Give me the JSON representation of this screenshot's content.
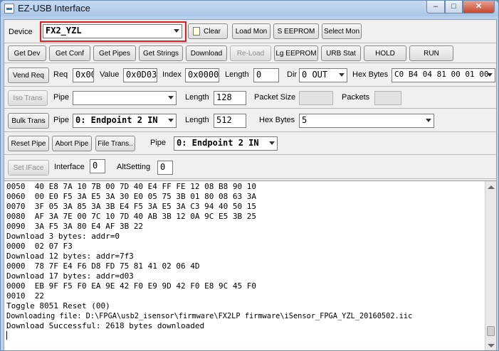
{
  "window": {
    "title": "EZ-USB Interface",
    "controls": {
      "minimize": "–",
      "maximize": "□",
      "close": "✕"
    }
  },
  "device_row": {
    "label": "Device",
    "device_value": "FX2_YZL",
    "clear": "Clear",
    "load_mon": "Load Mon",
    "s_eeprom": "S EEPROM",
    "select_mon": "Select Mon"
  },
  "get_row": {
    "buttons": [
      "Get Dev",
      "Get Conf",
      "Get Pipes",
      "Get Strings",
      "Download",
      "Re-Load",
      "Lg EEPROM",
      "URB Stat",
      "HOLD",
      "RUN"
    ]
  },
  "vend_row": {
    "button": "Vend Req",
    "req_label": "Req",
    "req_value": "0x00",
    "value_label": "Value",
    "value_value": "0x0D03",
    "index_label": "Index",
    "index_value": "0x0000",
    "length_label": "Length",
    "length_value": "0",
    "dir_label": "Dir",
    "dir_value": "0 OUT",
    "hex_label": "Hex Bytes",
    "hex_value": "C0 B4 04 81 00 01 00"
  },
  "iso_row": {
    "button": "Iso Trans",
    "pipe_label": "Pipe",
    "pipe_value": "",
    "length_label": "Length",
    "length_value": "128",
    "packet_size_label": "Packet Size",
    "packets_label": "Packets"
  },
  "bulk_row": {
    "button": "Bulk Trans",
    "pipe_label": "Pipe",
    "pipe_value": "0: Endpoint 2 IN",
    "length_label": "Length",
    "length_value": "512",
    "hex_label": "Hex Bytes",
    "hex_value": "5"
  },
  "pipe_row": {
    "reset_pipe": "Reset Pipe",
    "abort_pipe": "Abort Pipe",
    "file_trans": "File Trans..",
    "pipe_label": "Pipe",
    "pipe_value": "0: Endpoint 2 IN"
  },
  "iface_row": {
    "button": "Set IFace",
    "interface_label": "Interface",
    "interface_value": "0",
    "altsetting_label": "AltSetting",
    "altsetting_value": "0"
  },
  "log": {
    "lines": [
      "0050  40 E8 7A 10 7B 00 7D 40 E4 FF FE 12 08 B8 90 10",
      "0060  00 E0 F5 3A E5 3A 30 E0 05 75 3B 01 80 08 63 3A",
      "0070  3F 05 3A 85 3A 3B E4 F5 3A E5 3A C3 94 40 50 15",
      "0080  AF 3A 7E 00 7C 10 7D 40 AB 3B 12 0A 9C E5 3B 25",
      "0090  3A F5 3A 80 E4 AF 3B 22",
      "Download 3 bytes: addr=0",
      "0000  02 07 F3",
      "Download 12 bytes: addr=7f3",
      "0000  78 7F E4 F6 D8 FD 75 81 41 02 06 4D",
      "Download 17 bytes: addr=d03",
      "0000  EB 9F F5 F0 EA 9E 42 F0 E9 9D 42 F0 E8 9C 45 F0",
      "0010  22",
      "Toggle 8051 Reset (00)",
      "Downloading file: D:\\FPGA\\usb2_isensor\\firmware\\FX2LP firmware\\iSensor_FPGA_YZL_20160502.iic",
      "Download Successful: 2618 bytes downloaded"
    ]
  },
  "colors": {
    "highlight_box": "#e02020",
    "title_bar": "#b9d1ea",
    "close_button": "#c8452d"
  }
}
